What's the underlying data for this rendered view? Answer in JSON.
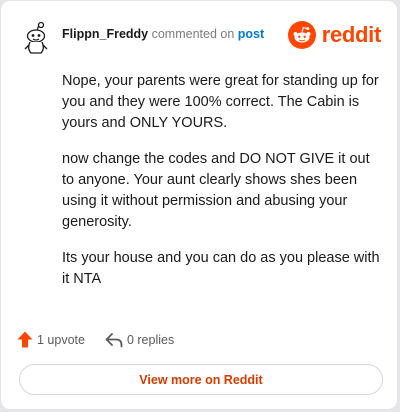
{
  "comment": {
    "username": "Flippn_Freddy",
    "action_text": "commented on",
    "post_link": "post",
    "paragraphs": [
      "Nope, your parents were great for standing up for you and they were 100% correct. The Cabin is yours and ONLY YOURS.",
      "now change the codes and DO NOT GIVE it out to anyone. Your aunt clearly shows shes been using it without permission and abusing your generosity.",
      "Its your house and you can do as you please with it NTA"
    ]
  },
  "brand": {
    "name": "reddit",
    "icon": "reddit-logo-icon",
    "color": "#ff4500"
  },
  "actions": {
    "upvote_label": "1 upvote",
    "upvote_icon": "upvote-arrow-icon",
    "replies_label": "0 replies",
    "replies_icon": "reply-arrow-icon"
  },
  "footer": {
    "view_more_label": "View more on Reddit"
  },
  "colors": {
    "accent": "#ff4500",
    "link": "#0079d3",
    "view_more": "#d93a00"
  }
}
